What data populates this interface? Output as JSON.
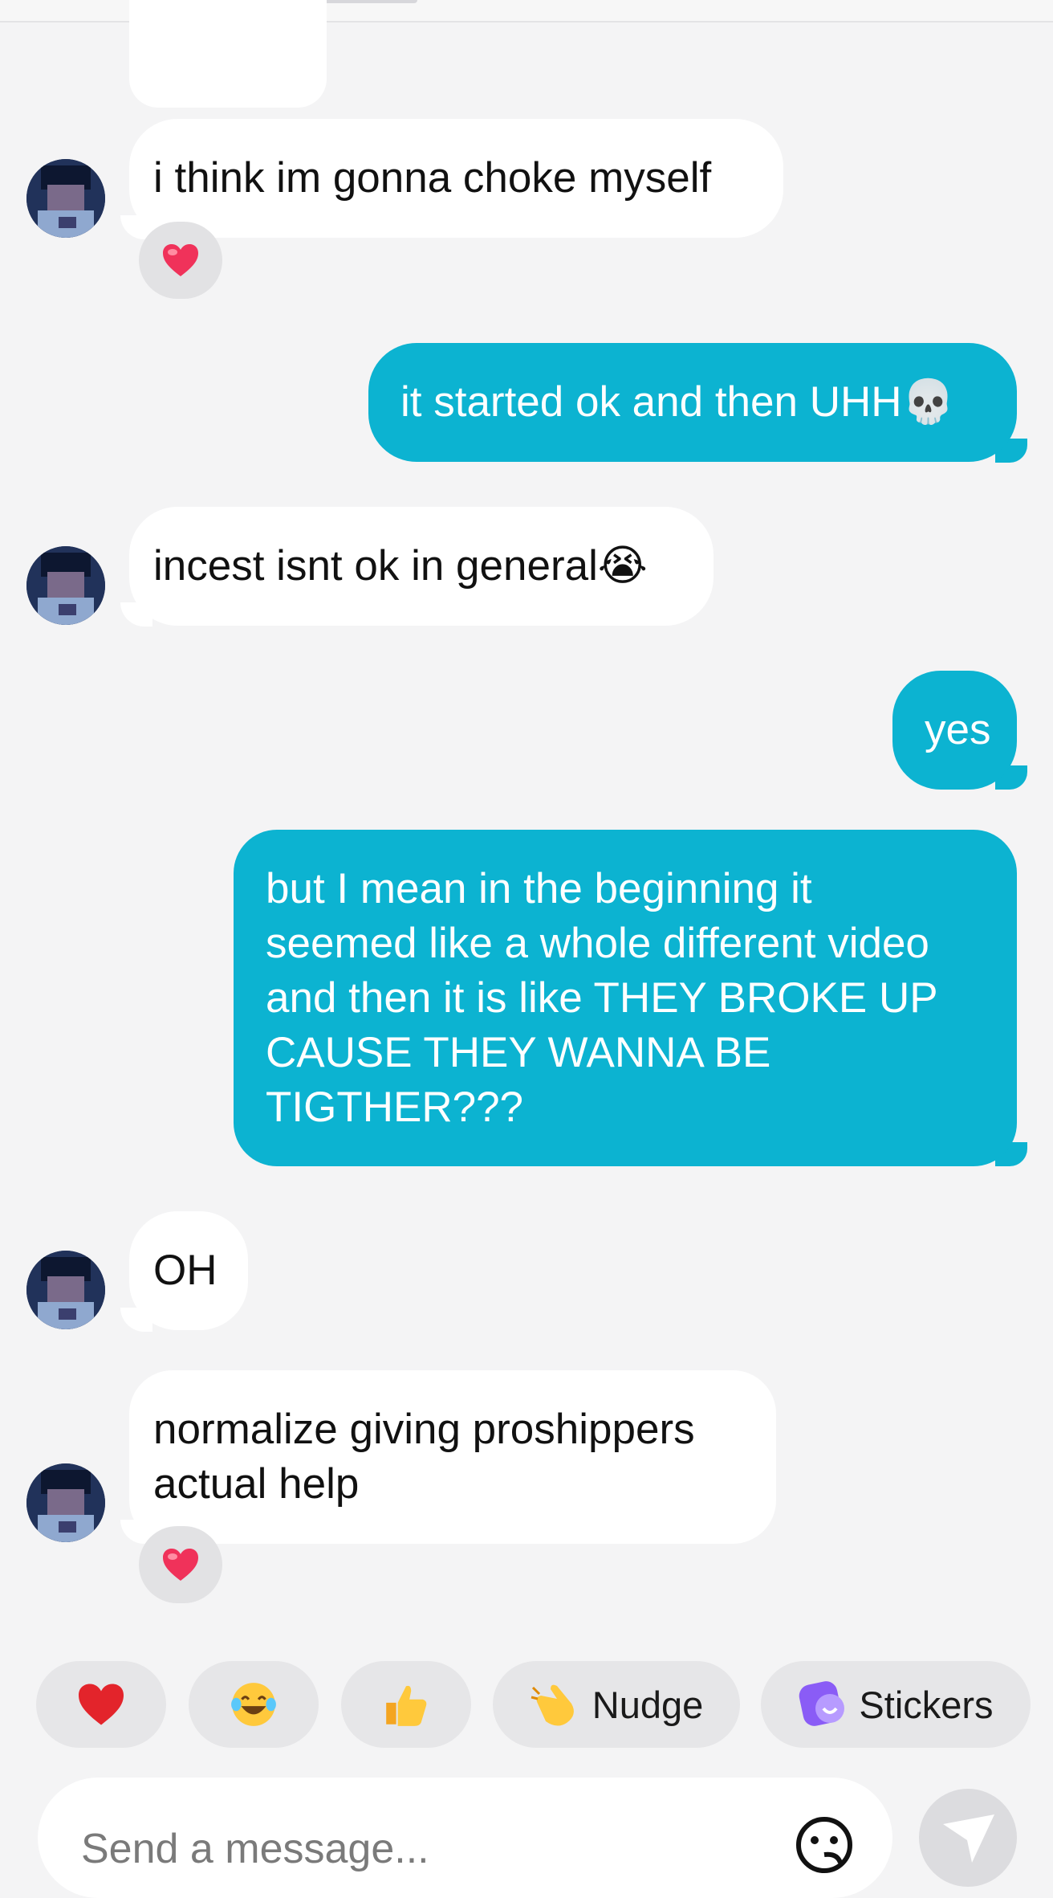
{
  "messages": [
    {
      "from": "them",
      "text": "i think im gonna choke myself",
      "reaction": "heart"
    },
    {
      "from": "me",
      "text": "it started ok and then UHH💀"
    },
    {
      "from": "them",
      "text": "incest isnt ok in general😭"
    },
    {
      "from": "me",
      "text": "yes"
    },
    {
      "from": "me",
      "lines": [
        "but I mean in the beginning it",
        "seemed like a whole different video",
        "and then it is like THEY BROKE UP",
        "CAUSE THEY WANNA BE",
        "TIGTHER???"
      ]
    },
    {
      "from": "them",
      "text": "OH"
    },
    {
      "from": "them",
      "lines": [
        "normalize giving proshippers",
        "actual help"
      ],
      "reaction": "heart"
    }
  ],
  "quick_reactions": [
    {
      "icon": "red-heart"
    },
    {
      "icon": "laughing-tears"
    },
    {
      "icon": "thumbs-up"
    },
    {
      "icon": "nudge-hand",
      "label": "Nudge"
    },
    {
      "icon": "stickers",
      "label": "Stickers"
    }
  ],
  "composer": {
    "placeholder": "Send a message..."
  },
  "colors": {
    "sent_bubble": "#0cb3d1",
    "received_bubble": "#ffffff",
    "background": "#f4f4f5",
    "chip": "#e6e6e8"
  }
}
